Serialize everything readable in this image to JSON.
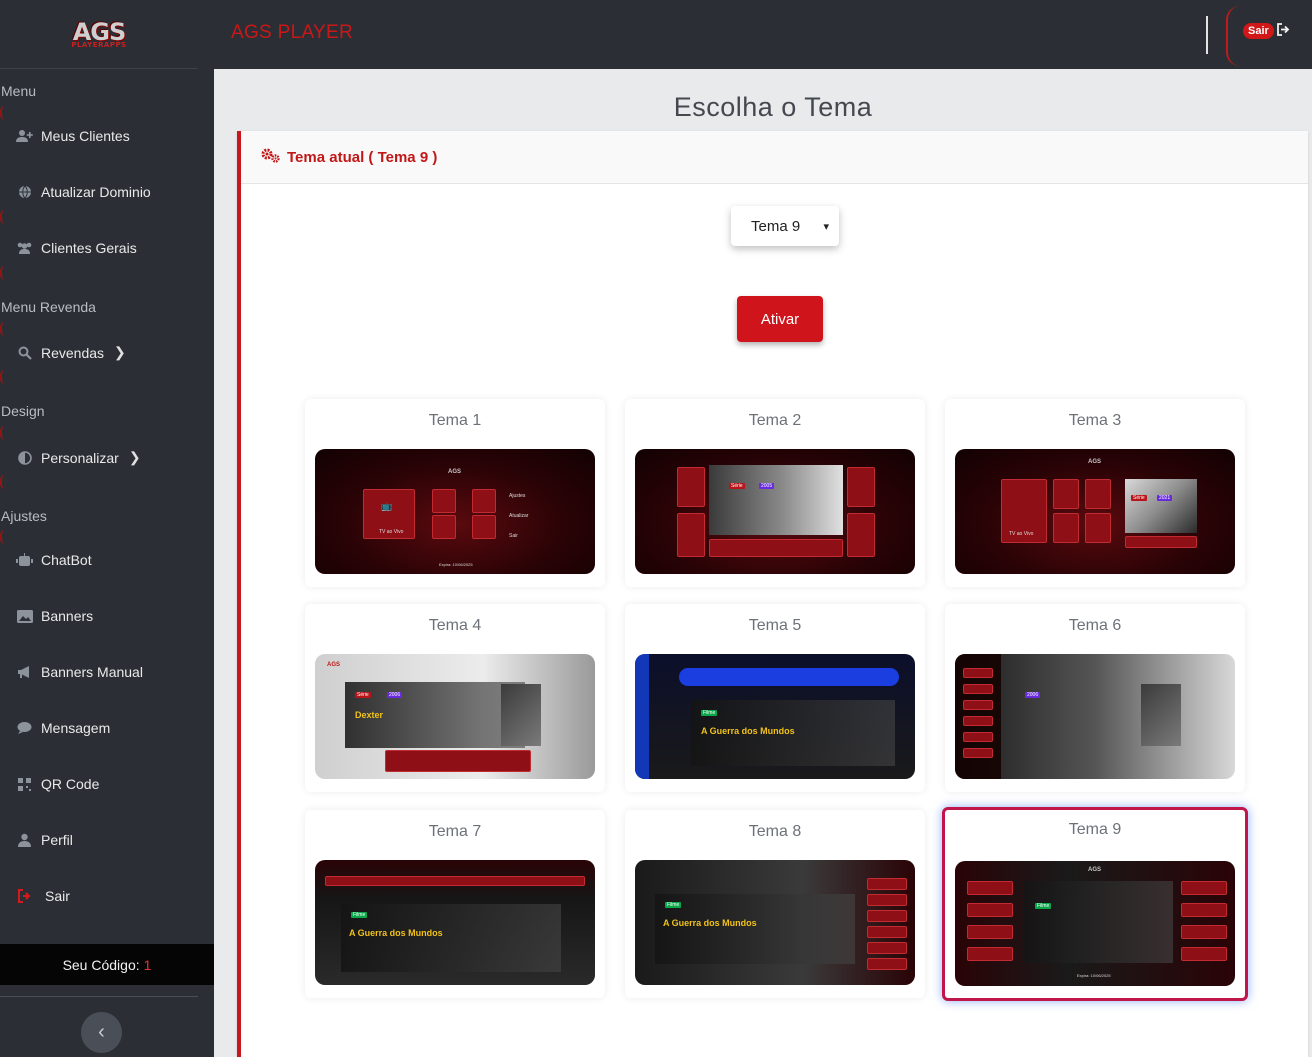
{
  "brand": {
    "logo_main": "AGS",
    "logo_sub": "PLAYERAPPS"
  },
  "header": {
    "app_title": "AGS PLAYER",
    "logout_label": "Sair"
  },
  "sidebar": {
    "section_menu": "Menu",
    "items_menu": [
      {
        "label": "Meus Clientes",
        "icon": "user-plus-icon"
      },
      {
        "label": "Atualizar Dominio",
        "icon": "globe-icon"
      },
      {
        "label": "Clientes Gerais",
        "icon": "users-icon"
      }
    ],
    "section_revenda": "Menu Revenda",
    "revendas_label": "Revendas",
    "section_design": "Design",
    "personalizar_label": "Personalizar",
    "section_ajustes": "Ajustes",
    "items_ajustes": [
      {
        "label": "ChatBot",
        "icon": "robot-icon"
      },
      {
        "label": "Banners",
        "icon": "image-icon"
      },
      {
        "label": "Banners Manual",
        "icon": "megaphone-icon"
      },
      {
        "label": "Mensagem",
        "icon": "comment-icon"
      },
      {
        "label": "QR Code",
        "icon": "qrcode-icon"
      },
      {
        "label": "Perfil",
        "icon": "user-icon"
      }
    ],
    "logout_label": "Sair",
    "code_label": "Seu Código:",
    "code_value": "1"
  },
  "main": {
    "page_title": "Escolha o Tema",
    "card_title": "Tema atual ( Tema 9 )",
    "select_value": "Tema 9",
    "activate_label": "Ativar",
    "active_theme": 9,
    "themes": [
      {
        "name": "Tema 1"
      },
      {
        "name": "Tema 2"
      },
      {
        "name": "Tema 3"
      },
      {
        "name": "Tema 4"
      },
      {
        "name": "Tema 5"
      },
      {
        "name": "Tema 6"
      },
      {
        "name": "Tema 7"
      },
      {
        "name": "Tema 8"
      },
      {
        "name": "Tema 9"
      }
    ],
    "preview_texts": {
      "tv_ao_vivo": "TV ao Vivo",
      "filmes": "Filmes",
      "series": "Séries",
      "lista": "Lista",
      "ajustes": "Ajustes",
      "atualizar": "Atualizar",
      "sair": "Sair",
      "sports": "Sports",
      "serie_tag": "Série",
      "filme_tag": "Filme",
      "year_2006": "2006",
      "year_2005": "2005",
      "year_2021": "2021",
      "dexter": "Dexter",
      "guerra": "A Guerra dos Mundos",
      "expira": "Expira: 10/06/2025"
    }
  },
  "colors": {
    "accent": "#c8161c",
    "sidebar_bg": "#2b2f35",
    "active_border": "#c0164a"
  }
}
